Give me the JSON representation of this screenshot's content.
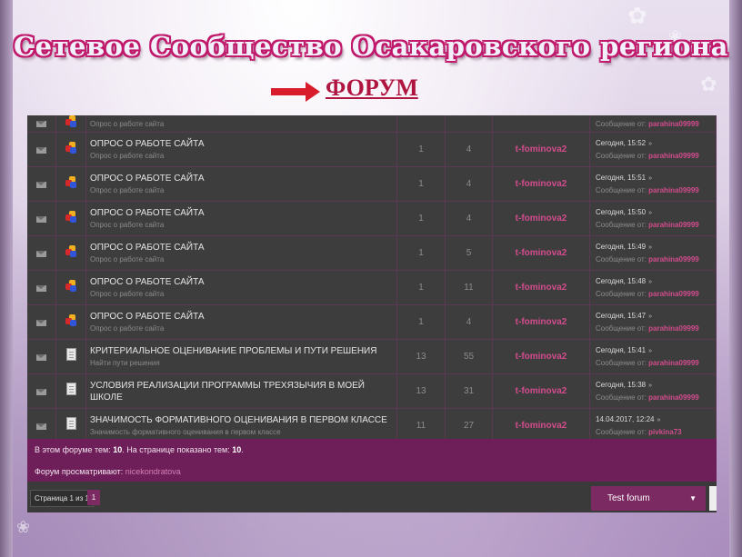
{
  "slide": {
    "title": "Сетевое Сообщество Осакаровского региона",
    "subtitle": "ФОРУМ"
  },
  "topics": [
    {
      "title": "",
      "desc": "Опрос о работе сайта",
      "replies": "1",
      "views": "4",
      "author": "t-fominova2",
      "last_date": "",
      "last_by": "parahina09999",
      "icon": "poll",
      "partial": true
    },
    {
      "title": "ОПРОС О РАБОТЕ САЙТА",
      "desc": "Опрос о работе сайта",
      "replies": "1",
      "views": "4",
      "author": "t-fominova2",
      "last_date": "Сегодня, 15:52",
      "last_by": "parahina09999",
      "icon": "poll"
    },
    {
      "title": "ОПРОС О РАБОТЕ САЙТА",
      "desc": "Опрос о работе сайта",
      "replies": "1",
      "views": "4",
      "author": "t-fominova2",
      "last_date": "Сегодня, 15:51",
      "last_by": "parahina09999",
      "icon": "poll"
    },
    {
      "title": "ОПРОС О РАБОТЕ САЙТА",
      "desc": "Опрос о работе сайта",
      "replies": "1",
      "views": "4",
      "author": "t-fominova2",
      "last_date": "Сегодня, 15:50",
      "last_by": "parahina09999",
      "icon": "poll"
    },
    {
      "title": "ОПРОС О РАБОТЕ САЙТА",
      "desc": "Опрос о работе сайта",
      "replies": "1",
      "views": "5",
      "author": "t-fominova2",
      "last_date": "Сегодня, 15:49",
      "last_by": "parahina09999",
      "icon": "poll"
    },
    {
      "title": "ОПРОС О РАБОТЕ САЙТА",
      "desc": "Опрос о работе сайта",
      "replies": "1",
      "views": "11",
      "author": "t-fominova2",
      "last_date": "Сегодня, 15:48",
      "last_by": "parahina09999",
      "icon": "poll"
    },
    {
      "title": "ОПРОС О РАБОТЕ САЙТА",
      "desc": "Опрос о работе сайта",
      "replies": "1",
      "views": "4",
      "author": "t-fominova2",
      "last_date": "Сегодня, 15:47",
      "last_by": "parahina09999",
      "icon": "poll"
    },
    {
      "title": "КРИТЕРИАЛЬНОЕ ОЦЕНИВАНИЕ ПРОБЛЕМЫ И ПУТИ РЕШЕНИЯ",
      "desc": "Найти пути решения",
      "replies": "13",
      "views": "55",
      "author": "t-fominova2",
      "last_date": "Сегодня, 15:41",
      "last_by": "parahina09999",
      "icon": "doc"
    },
    {
      "title": "УСЛОВИЯ РЕАЛИЗАЦИИ ПРОГРАММЫ ТРЕХЯЗЫЧИЯ В МОЕЙ ШКОЛЕ",
      "desc": "",
      "replies": "13",
      "views": "31",
      "author": "t-fominova2",
      "last_date": "Сегодня, 15:38",
      "last_by": "parahina09999",
      "icon": "doc"
    },
    {
      "title": "ЗНАЧИМОСТЬ ФОРМАТИВНОГО ОЦЕНИВАНИЯ В ПЕРВОМ КЛАССЕ",
      "desc": "Значимость формативного оценивания в первом классе",
      "replies": "11",
      "views": "27",
      "author": "t-fominova2",
      "last_date": "14.04.2017, 12:24",
      "last_by": "pivkina73",
      "icon": "doc"
    }
  ],
  "labels": {
    "last_by_prefix": "Сообщение от:",
    "goto_glyph": "»"
  },
  "info": {
    "topics_prefix": "В этом форуме тем:",
    "topics_count": "10",
    "shown_prefix": ". На странице показано тем:",
    "shown_count": "10",
    "shown_suffix": ".",
    "viewing_prefix": "Форум просматривают:",
    "viewing_user": "nicekondratova"
  },
  "pagination": {
    "label": "Страница 1 из 1",
    "current": "1"
  },
  "jump": {
    "value": "Test forum",
    "caret": "▼"
  },
  "colors": {
    "accent": "#7b2a62",
    "author": "#d24c8c",
    "title_outline": "#c0186a",
    "heading": "#b01540"
  }
}
